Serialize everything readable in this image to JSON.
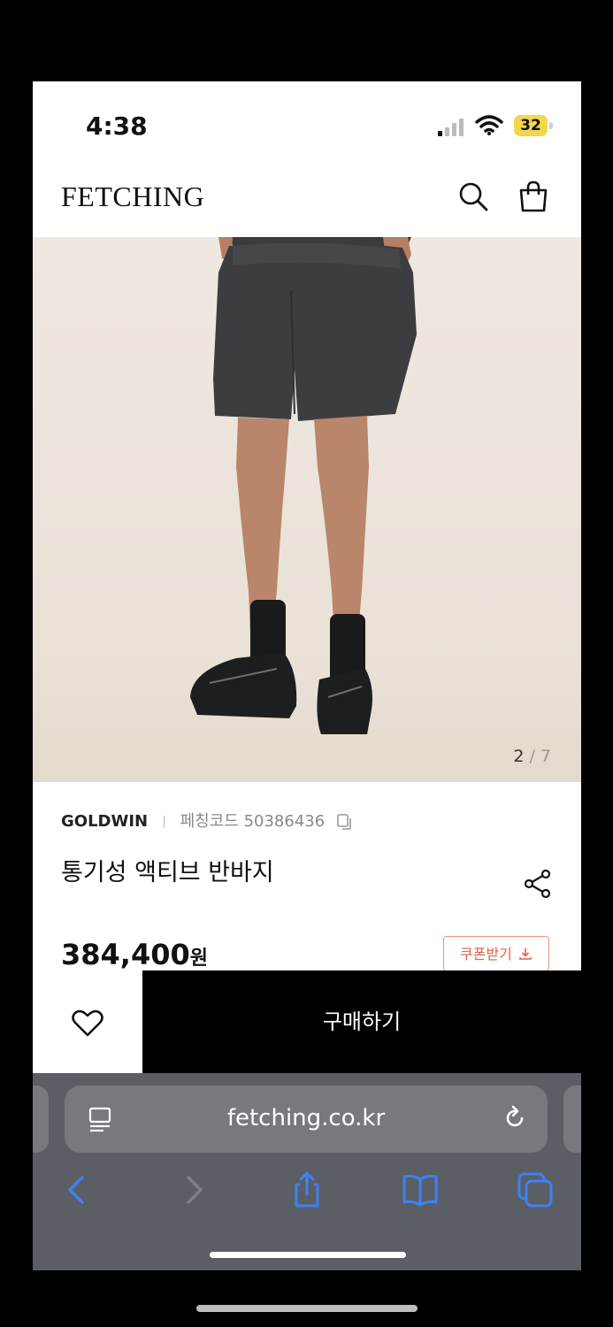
{
  "status_bar": {
    "time": "4:38",
    "battery": "32",
    "icons": [
      "signal-icon",
      "wifi-icon",
      "battery-icon"
    ]
  },
  "header": {
    "logo": "FETCHING",
    "icons": [
      "search-icon",
      "shopping-bag-icon"
    ]
  },
  "gallery": {
    "current": "2",
    "separator": "/",
    "total": "7"
  },
  "product": {
    "brand": "GOLDWIN",
    "code_label": "페칭코드",
    "code": "50386436",
    "name": "통기성 액티브 반바지",
    "price": "384,400",
    "currency": "원",
    "coupon_label": "쿠폰받기"
  },
  "actions": {
    "buy_label": "구매하기",
    "wish_icon": "heart-icon"
  },
  "browser": {
    "url": "fetching.co.kr",
    "icons": [
      "reader-icon",
      "reload-icon",
      "back-icon",
      "forward-icon",
      "share-icon",
      "bookmarks-icon",
      "tabs-icon"
    ]
  },
  "colors": {
    "coupon_accent": "#e0603f",
    "buy_button": "#000000",
    "nav_blue": "#3b82f6",
    "safari_bar": "#5c5e65"
  }
}
